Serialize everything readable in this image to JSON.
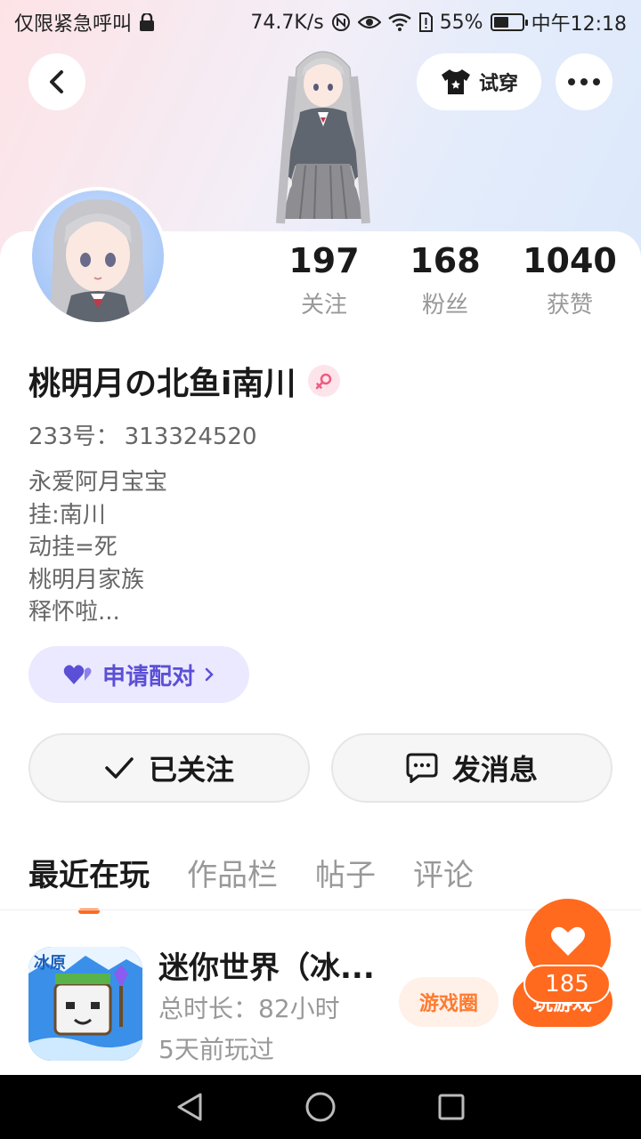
{
  "status_bar": {
    "left_text": "仅限紧急呼叫",
    "speed": "74.7K/s",
    "battery": "55%",
    "time": "中午12:18",
    "battery_level": 0.55
  },
  "header": {
    "tryon_label": "试穿"
  },
  "profile": {
    "stats": [
      {
        "num": "197",
        "label": "关注"
      },
      {
        "num": "168",
        "label": "粉丝"
      },
      {
        "num": "1040",
        "label": "获赞"
      }
    ],
    "nickname": "桃明月の北鱼i南川",
    "uid_label": "233号：",
    "uid_value": "313324520",
    "bio": [
      "永爱阿月宝宝",
      "挂:南川",
      "动挂=死",
      "桃明月家族",
      "释怀啦..."
    ],
    "pair_label": "申请配对",
    "follow_label": "已关注",
    "message_label": "发消息"
  },
  "tabs": [
    "最近在玩",
    "作品栏",
    "帖子",
    "评论"
  ],
  "game": {
    "title": "迷你世界（冰...",
    "duration": "总时长：82小时",
    "last_played": "5天前玩过",
    "circle_label": "游戏圈",
    "play_label": "玩游戏",
    "icon_text": "冰原"
  },
  "like": {
    "count": "185"
  },
  "colors": {
    "accent": "#ff6a1f",
    "pair_purple": "#5b4fd6"
  }
}
